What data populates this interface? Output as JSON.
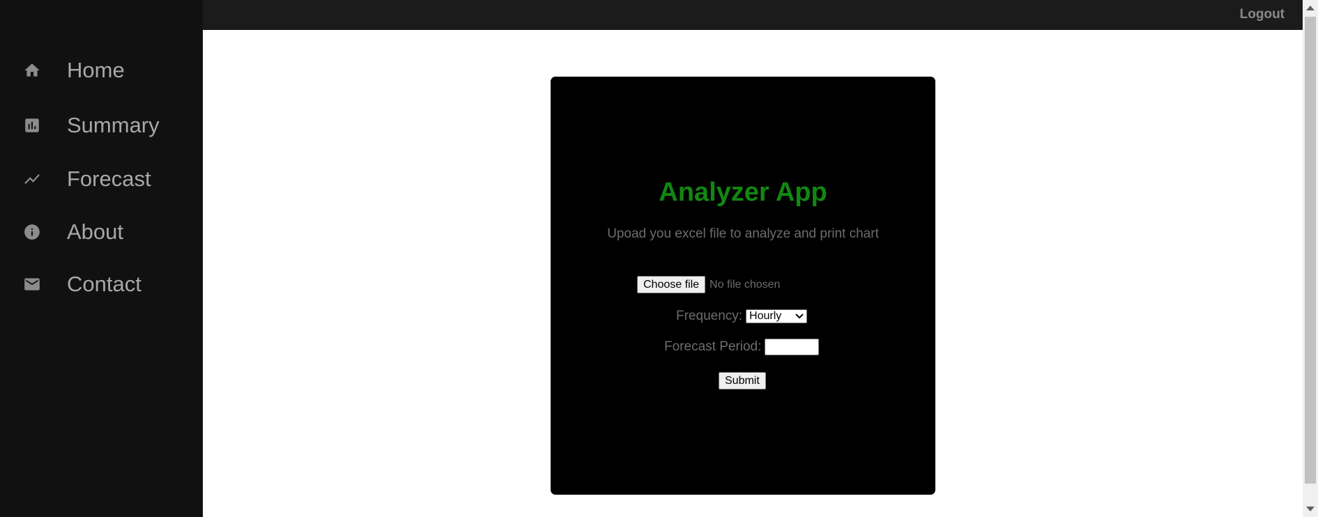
{
  "sidebar": {
    "items": [
      {
        "label": "Home",
        "icon": "home-icon"
      },
      {
        "label": "Summary",
        "icon": "summary-chart-icon"
      },
      {
        "label": "Forecast",
        "icon": "trend-line-icon"
      },
      {
        "label": "About",
        "icon": "info-icon"
      },
      {
        "label": "Contact",
        "icon": "mail-icon"
      }
    ]
  },
  "topbar": {
    "logout_label": "Logout"
  },
  "form": {
    "title": "Analyzer App",
    "subtitle": "Upoad you excel file to analyze and print chart",
    "choose_file_label": "Choose file",
    "file_status": "No file chosen",
    "frequency_label": "Frequency:",
    "frequency_value": "Hourly",
    "forecast_period_label": "Forecast Period:",
    "forecast_period_value": "",
    "submit_label": "Submit"
  },
  "colors": {
    "title": "#118811",
    "sidebar_bg": "#111111",
    "topbar_bg": "#1b1b1b",
    "card_bg": "#000000"
  }
}
